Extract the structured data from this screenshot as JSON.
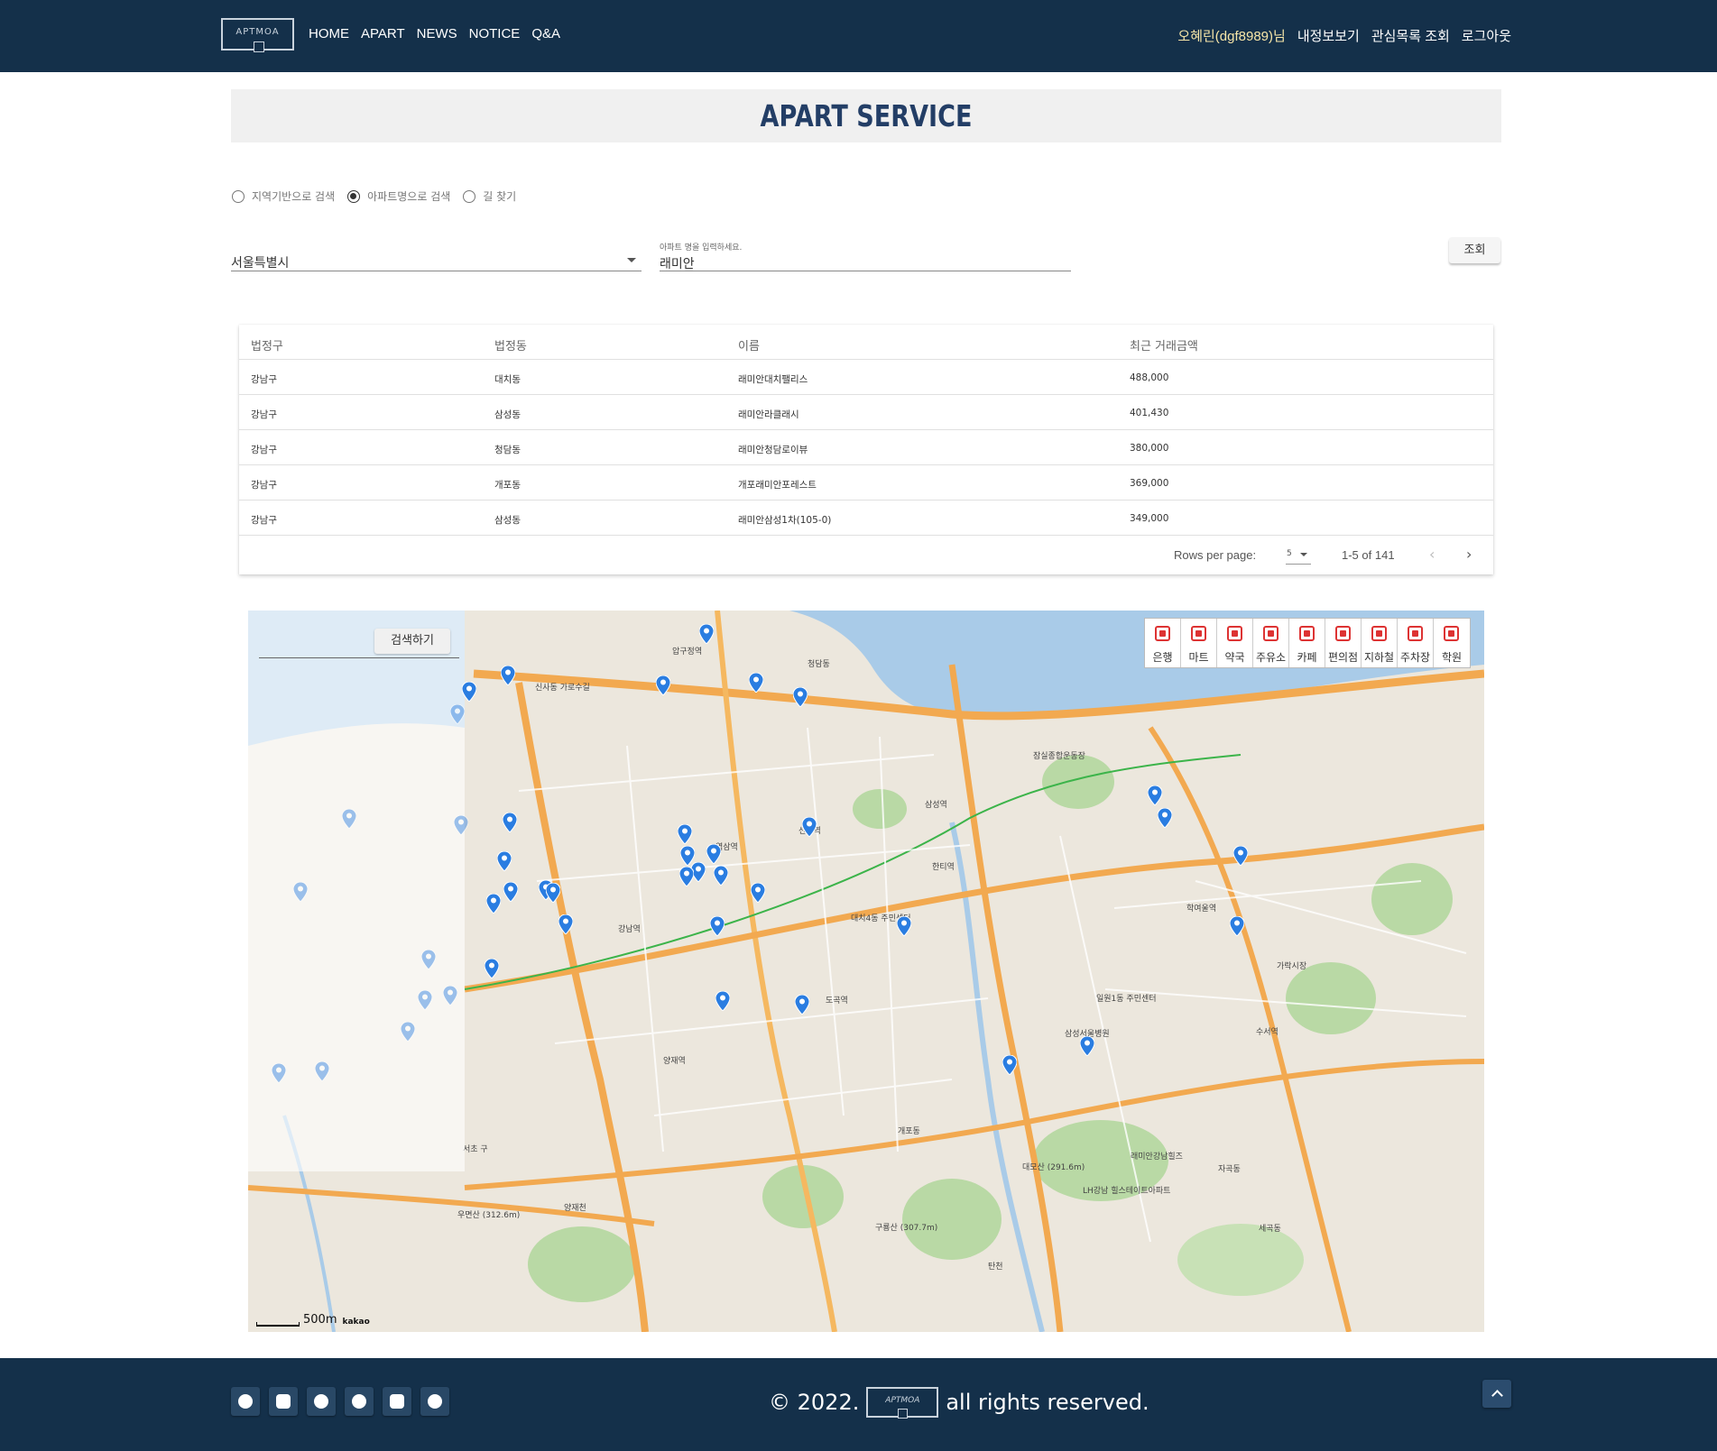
{
  "header": {
    "logo_text": "APTMOA",
    "nav": [
      "HOME",
      "APART",
      "NEWS",
      "NOTICE",
      "Q&A"
    ],
    "user_name": "오혜린(dgf8989)님",
    "links": [
      "내정보보기",
      "관심목록 조회",
      "로그아웃"
    ]
  },
  "banner": {
    "title": "APART SERVICE"
  },
  "search_modes": [
    {
      "label": "지역기반으로 검색",
      "selected": false
    },
    {
      "label": "아파트명으로 검색",
      "selected": true
    },
    {
      "label": "길 찾기",
      "selected": false
    }
  ],
  "form": {
    "city_value": "서울특별시",
    "apt_label": "아파트 명을 입력하세요.",
    "apt_value": "래미안",
    "query_button": "조회"
  },
  "table": {
    "headers": [
      "법정구",
      "법정동",
      "이름",
      "최근 거래금액"
    ],
    "rows": [
      [
        "강남구",
        "대치동",
        "래미안대치팰리스",
        "488,000"
      ],
      [
        "강남구",
        "삼성동",
        "래미안라클래시",
        "401,430"
      ],
      [
        "강남구",
        "청담동",
        "래미안청담로이뷰",
        "380,000"
      ],
      [
        "강남구",
        "개포동",
        "개포래미안포레스트",
        "369,000"
      ],
      [
        "강남구",
        "삼성동",
        "래미안삼성1차(105-0)",
        "349,000"
      ]
    ],
    "rows_per_page_label": "Rows per page:",
    "rows_per_page": "5",
    "range": "1-5 of 141"
  },
  "map": {
    "search_button": "검색하기",
    "categories": [
      "은행",
      "마트",
      "약국",
      "주유소",
      "카페",
      "편의점",
      "지하철",
      "주차장",
      "학원"
    ],
    "scale": "500m",
    "provider": "kakao",
    "labels": [
      "신사동 가로수길",
      "압구정역",
      "청담동",
      "잠실종합운동장",
      "삼성역",
      "선릉역",
      "대치4동 주민센터",
      "도곡역",
      "양재역",
      "강남역",
      "역삼역",
      "개포동",
      "수서역",
      "가락시장",
      "탄천",
      "서초 구",
      "양재천",
      "구룡산 (307.7m)",
      "대모산 (291.6m)",
      "우면산 (312.6m)",
      "래미안강남힐즈",
      "세곡동",
      "자곡동",
      "LH강남 힐스테이트아파트",
      "일원1동 주민센터",
      "삼성서울병원",
      "한티역",
      "학여울역"
    ],
    "pin_color": "#2a7de1"
  },
  "footer": {
    "copyright_prefix": "© 2022.",
    "logo_text": "APTMOA",
    "copyright_suffix": "all rights reserved.",
    "social_icons": [
      "twitter-icon",
      "instagram-icon",
      "facebook-icon",
      "reddit-icon",
      "discord-icon",
      "pinterest-icon"
    ]
  }
}
